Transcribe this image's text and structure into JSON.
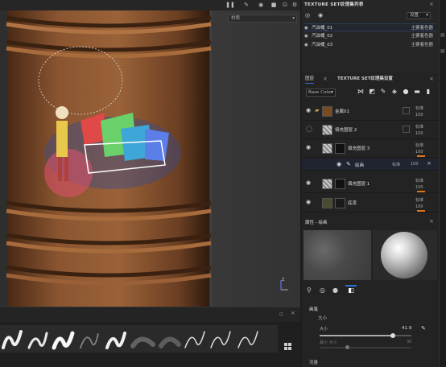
{
  "viewport": {
    "material_dropdown": "材质",
    "toolbar_icons": [
      "pause-icon",
      "brush-mode-icon",
      "camera-icon",
      "video-icon",
      "screenshot-icon",
      "settings-icon"
    ]
  },
  "texture_set_list": {
    "title": "TEXTURE SET纹理集列表",
    "settings_label": "设置",
    "items": [
      {
        "name": "汽油桶_01",
        "shader": "主要着色器",
        "selected": true
      },
      {
        "name": "汽油桶_02",
        "shader": "主要着色器",
        "selected": false
      },
      {
        "name": "汽油桶_03",
        "shader": "主要着色器",
        "selected": false
      }
    ]
  },
  "layers": {
    "tab_layers": "图层",
    "tab_settings": "TEXTURE SET纹理集设置",
    "channel": "Base Color",
    "items": [
      {
        "name": "金属01",
        "blend": "标准",
        "opacity": "100",
        "type": "folder"
      },
      {
        "name": "填充图层 2",
        "blend": "标准",
        "opacity": "100",
        "type": "fill"
      },
      {
        "name": "填充图层 3",
        "blend": "标准",
        "opacity": "100",
        "type": "fill"
      },
      {
        "name": "绘画",
        "blend": "标准",
        "opacity": "100",
        "type": "paint"
      },
      {
        "name": "填充图层 1",
        "blend": "标准",
        "opacity": "100",
        "type": "fill"
      },
      {
        "name": "底漆",
        "blend": "标准",
        "opacity": "100",
        "type": "fill"
      }
    ]
  },
  "properties": {
    "title": "属性 - 绘画",
    "section": "画笔",
    "size_label": "大小",
    "size_slider_label": "大小",
    "size_value": "41.9",
    "size_fraction": 0.8,
    "min_label": "最小 大小",
    "min_value": "30",
    "last_label": "流量"
  },
  "colors": {
    "accent_blue": "#2c6fd6",
    "opacity_orange": "#e0761a"
  }
}
